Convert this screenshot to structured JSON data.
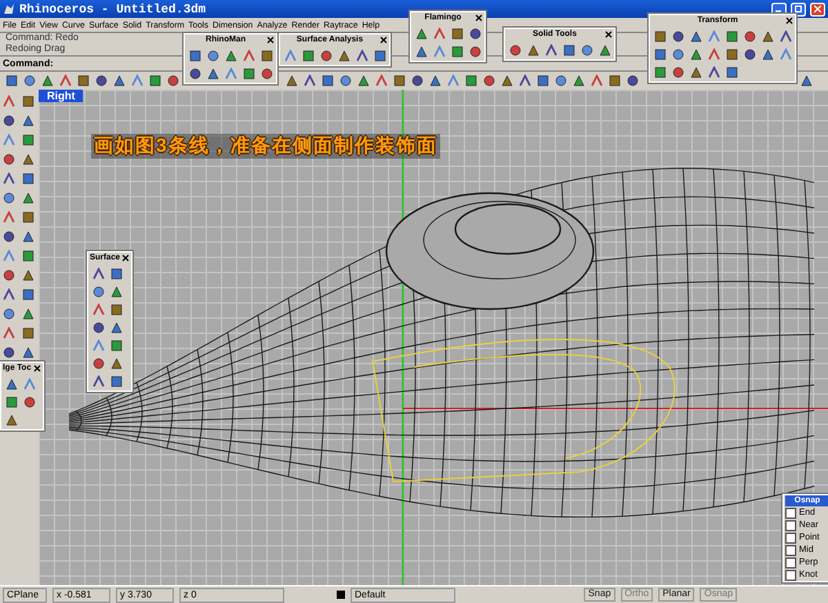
{
  "window": {
    "title": "Rhinoceros - Untitled.3dm"
  },
  "menu": [
    "File",
    "Edit",
    "View",
    "Curve",
    "Surface",
    "Solid",
    "Transform",
    "Tools",
    "Dimension",
    "Analyze",
    "Render",
    "Raytrace",
    "Help"
  ],
  "command_history": [
    "Command: Redo",
    "Redoing Drag"
  ],
  "command_prompt": "Command:",
  "floating_toolbars": [
    {
      "title": "RhinoMan"
    },
    {
      "title": "Surface Analysis"
    },
    {
      "title": "Flamingo"
    },
    {
      "title": "Solid Tools"
    },
    {
      "title": "Transform"
    },
    {
      "title": "Surface"
    },
    {
      "title": "lge Toc"
    }
  ],
  "viewport": {
    "label": "Right",
    "annotation": "画如图3条线，准备在侧面制作装饰面"
  },
  "osnap": {
    "title": "Osnap",
    "items": [
      {
        "label": "End",
        "checked": false
      },
      {
        "label": "Near",
        "checked": false
      },
      {
        "label": "Point",
        "checked": false
      },
      {
        "label": "Mid",
        "checked": false
      },
      {
        "label": "Perp",
        "checked": false
      },
      {
        "label": "Knot",
        "checked": false
      }
    ]
  },
  "status_bar": {
    "cplane": "CPlane",
    "x": "x -0.581",
    "y": "y 3.730",
    "z": "z 0",
    "layer": "Default",
    "toggles": [
      {
        "label": "Snap",
        "disabled": false
      },
      {
        "label": "Ortho",
        "disabled": true
      },
      {
        "label": "Planar",
        "disabled": false
      },
      {
        "label": "Osnap",
        "disabled": true
      }
    ]
  }
}
